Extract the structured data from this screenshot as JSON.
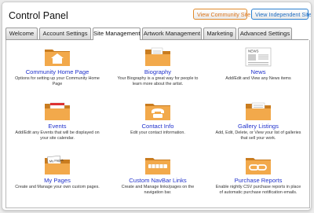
{
  "header": {
    "title": "Control Panel",
    "community_btn": "View Community Site",
    "independent_btn": "View Independent Site"
  },
  "tabs": [
    {
      "label": "Welcome",
      "active": false
    },
    {
      "label": "Account Settings",
      "active": false
    },
    {
      "label": "Site Management",
      "active": true
    },
    {
      "label": "Artwork Management",
      "active": false
    },
    {
      "label": "Marketing",
      "active": false
    },
    {
      "label": "Advanced Settings",
      "active": false
    }
  ],
  "items": [
    {
      "label": "Community Home Page",
      "desc": "Options for setting up your Community Home Page",
      "icon": "home-icon"
    },
    {
      "label": "Biography",
      "desc": "Your Biography is a great way for people to learn more about the artist.",
      "icon": "document-icon"
    },
    {
      "label": "News",
      "desc": "Add/Edit and View any News items",
      "icon": "newspaper-icon"
    },
    {
      "label": "Events",
      "desc": "Add/Edit any Events that will be displayed on your site calendar.",
      "icon": "calendar-icon"
    },
    {
      "label": "Contact Info",
      "desc": "Edit your contact information.",
      "icon": "telephone-icon"
    },
    {
      "label": "Gallery Listings",
      "desc": "Add, Edit, Delete, or View your list of galleries that sell your work.",
      "icon": "gallery-icon"
    },
    {
      "label": "My Pages",
      "desc": "Create and Manage your own custom pages.",
      "icon": "pages-icon"
    },
    {
      "label": "Custom NavBar Links",
      "desc": "Create and Manage links/pages on the navigation bar.",
      "icon": "navbar-links-icon"
    },
    {
      "label": "Purchase Reports",
      "desc": "Enable nightly CSV purchase reports in place of automatic purchase notification emails.",
      "icon": "chain-link-icon"
    }
  ],
  "icon_texts": {
    "news_header": "NEWS",
    "my_pages": "My Pages"
  },
  "colors": {
    "folder": "#f2a94b",
    "folder_dark": "#c97c1f",
    "link": "#2233cc",
    "community_accent": "#e08a2a",
    "independent_accent": "#2a7fd0"
  }
}
